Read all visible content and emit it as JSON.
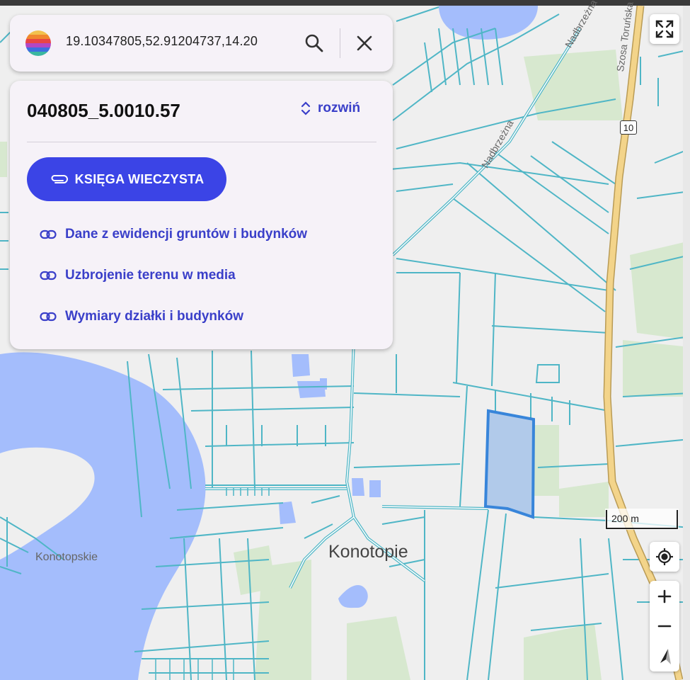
{
  "search": {
    "query": "19.10347805,52.91204737,14.20"
  },
  "panel": {
    "parcel_id": "040805_5.0010.57",
    "expand_label": "rozwiń",
    "primary_button": "KSIĘGA WIECZYSTA",
    "links": [
      "Dane z ewidencji gruntów i budynków",
      "Uzbrojenie terenu w media",
      "Wymiary działki i budynków"
    ]
  },
  "map": {
    "places": [
      "Konotopie",
      "Konotopskie"
    ],
    "streets": [
      "Szosa Toruńska",
      "Nadbrzeżna",
      "Nadbrzeżna"
    ],
    "road_number": "10",
    "scale_label": "200 m",
    "colors": {
      "water": "#a4bdfc",
      "parcel_lines": "#4fb6c6",
      "highlight": "#2f80d9",
      "road": "#f3d48a",
      "green": "#d7e8cf"
    }
  },
  "controls": {
    "icons": [
      "fullscreen-icon",
      "locate-icon",
      "zoom-in-icon",
      "zoom-out-icon",
      "compass-icon"
    ]
  }
}
